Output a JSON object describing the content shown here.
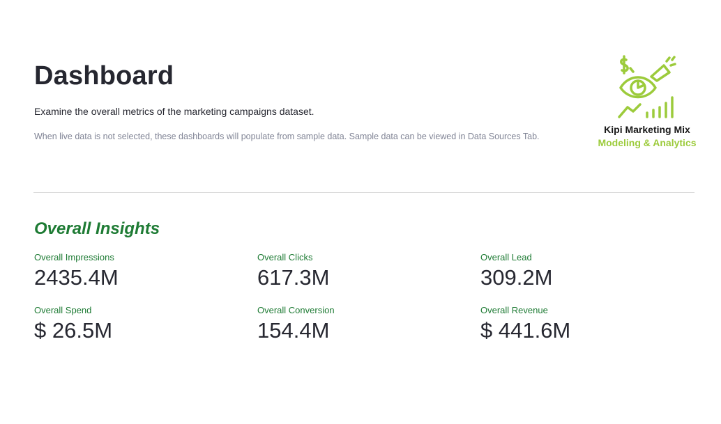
{
  "header": {
    "title": "Dashboard",
    "subtitle": "Examine the overall metrics of the marketing campaigns dataset.",
    "note": "When live data is not selected, these dashboards will populate from sample data. Sample data can be viewed in Data Sources Tab."
  },
  "logo": {
    "icon": "eye-megaphone-dollar-chart-icon",
    "line1": "Kipi Marketing Mix",
    "line2": "Modeling & Analytics",
    "brand_color": "#9ccb3b"
  },
  "insights": {
    "title": "Overall Insights",
    "accent_color": "#1e7b34",
    "metrics": [
      {
        "label": "Overall Impressions",
        "value": "2435.4M"
      },
      {
        "label": "Overall Clicks",
        "value": "617.3M"
      },
      {
        "label": "Overall Lead",
        "value": "309.2M"
      },
      {
        "label": "Overall Spend",
        "value": "$ 26.5M"
      },
      {
        "label": "Overall Conversion",
        "value": "154.4M"
      },
      {
        "label": "Overall Revenue",
        "value": "$ 441.6M"
      }
    ]
  }
}
